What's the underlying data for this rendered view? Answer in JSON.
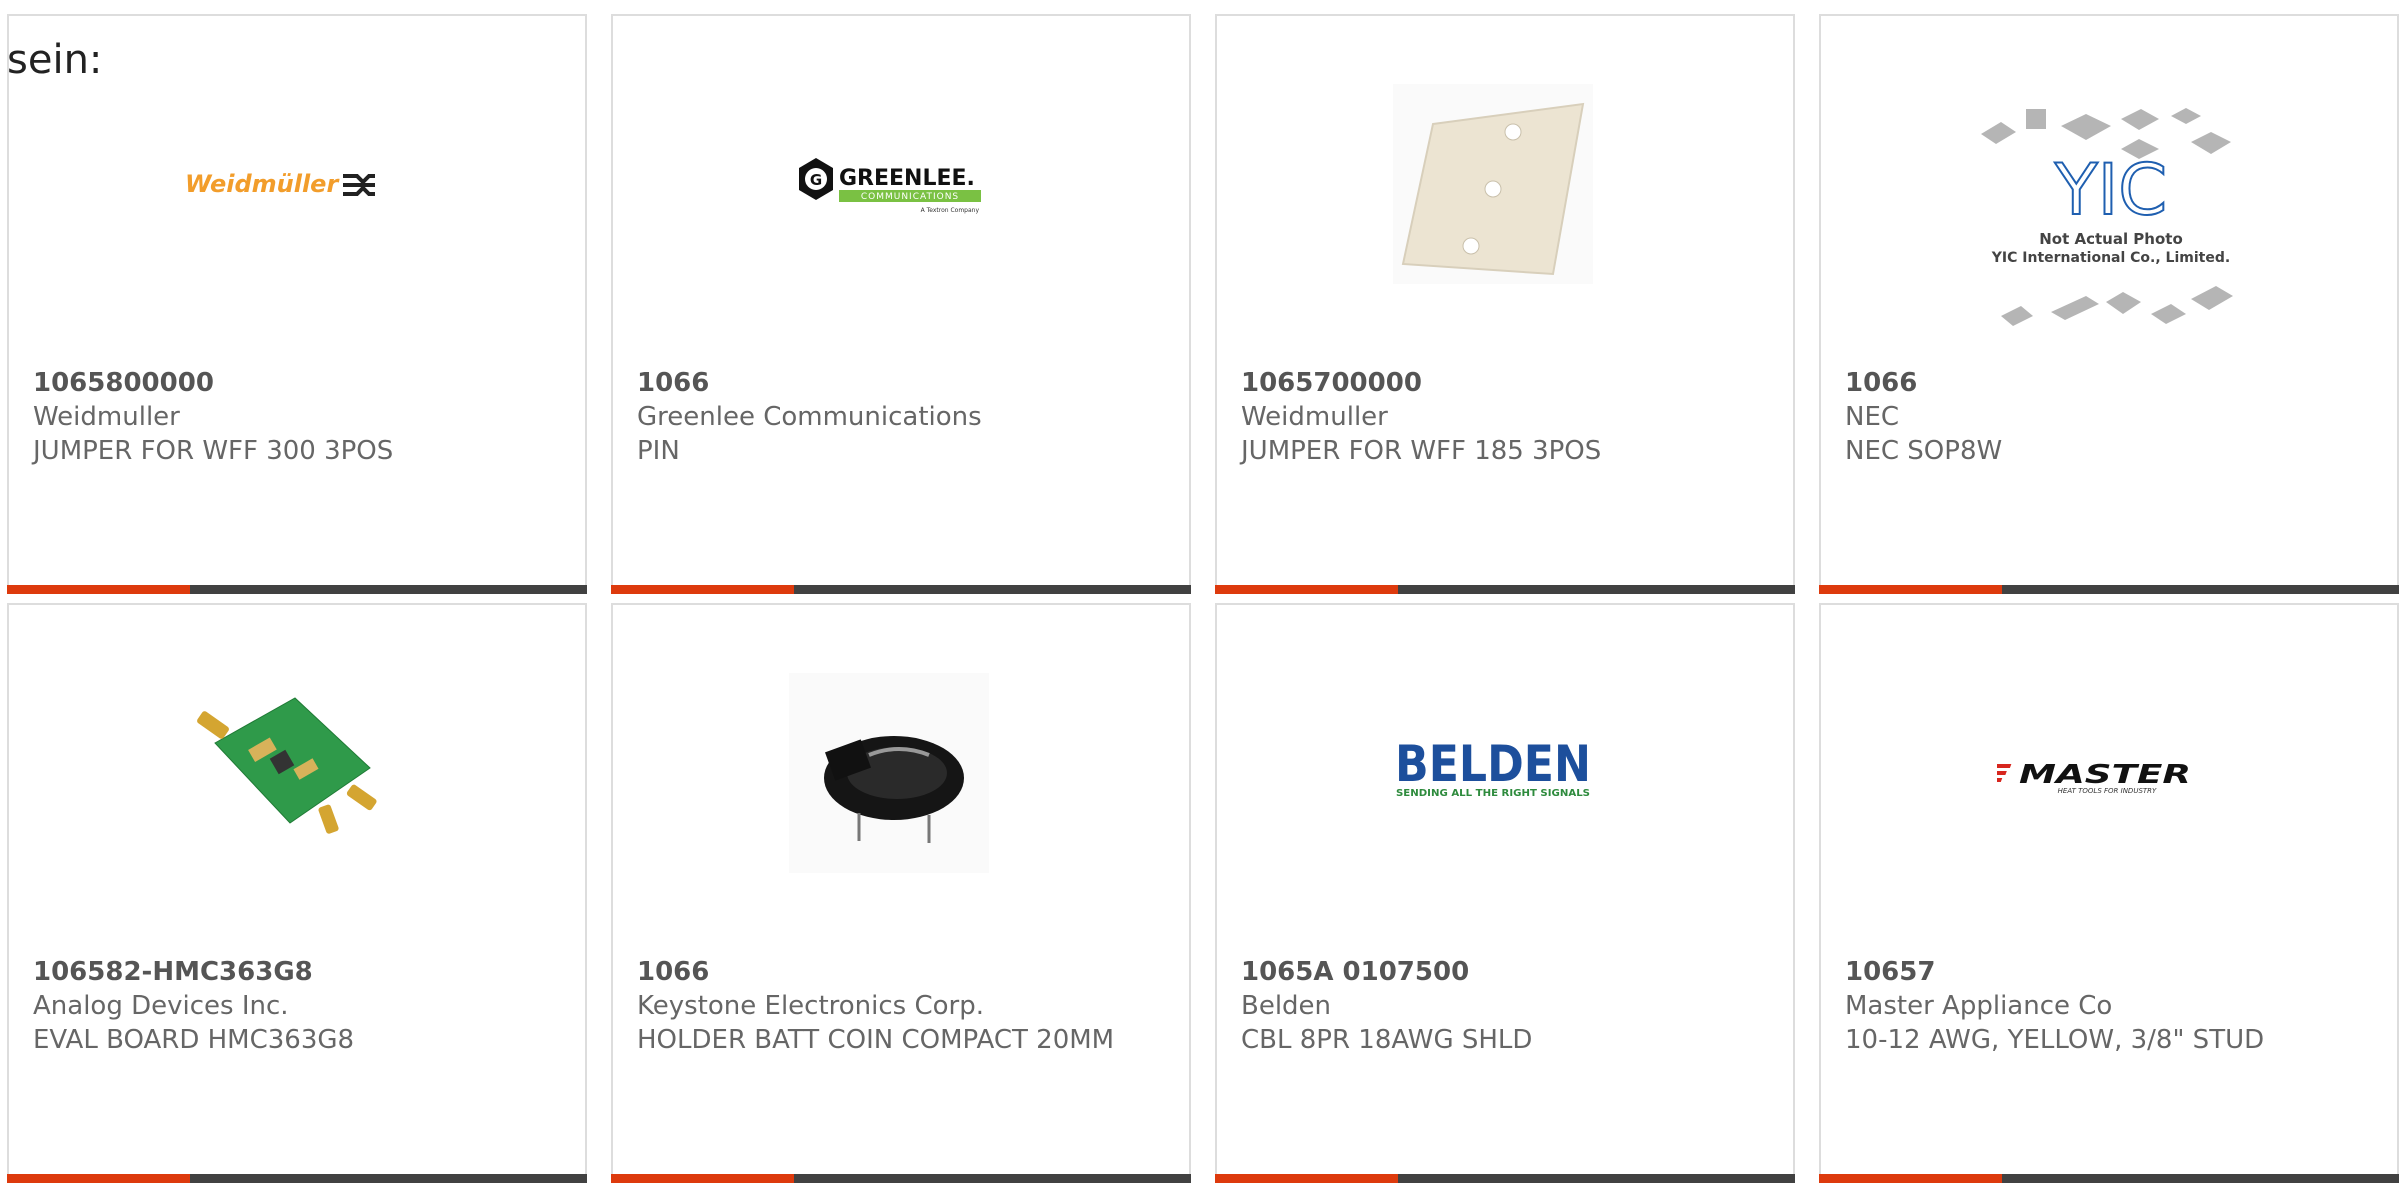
{
  "prefix": "sein:",
  "colors": {
    "accent": "#dd3a0d",
    "bar": "#414141",
    "border": "#dddddd",
    "text": "#666666"
  },
  "products": [
    {
      "part_number": "1065800000",
      "manufacturer": "Weidmuller",
      "description": "JUMPER FOR WFF 300 3POS",
      "logo_text": "Weidmüller"
    },
    {
      "part_number": "1066",
      "manufacturer": "Greenlee Communications",
      "description": "PIN",
      "logo_text": "GREENLEE.",
      "logo_sub": "COMMUNICATIONS",
      "logo_tag": "A Textron Company"
    },
    {
      "part_number": "1065700000",
      "manufacturer": "Weidmuller",
      "description": "JUMPER FOR WFF 185 3POS"
    },
    {
      "part_number": "1066",
      "manufacturer": "NEC",
      "description": "NEC SOP8W",
      "logo_text": "YIC",
      "note_1": "Not Actual Photo",
      "note_2": "YIC International Co., Limited."
    },
    {
      "part_number": "106582-HMC363G8",
      "manufacturer": "Analog Devices Inc.",
      "description": "EVAL BOARD HMC363G8"
    },
    {
      "part_number": "1066",
      "manufacturer": "Keystone Electronics Corp.",
      "description": "HOLDER BATT COIN COMPACT 20MM"
    },
    {
      "part_number": "1065A 0107500",
      "manufacturer": "Belden",
      "description": "CBL 8PR 18AWG SHLD",
      "logo_text": "BELDEN",
      "logo_sub": "SENDING ALL THE RIGHT SIGNALS"
    },
    {
      "part_number": "10657",
      "manufacturer": "Master Appliance Co",
      "description": "10-12 AWG, YELLOW, 3/8\" STUD",
      "logo_text": "MASTER",
      "logo_sub": "HEAT TOOLS FOR INDUSTRY"
    }
  ]
}
